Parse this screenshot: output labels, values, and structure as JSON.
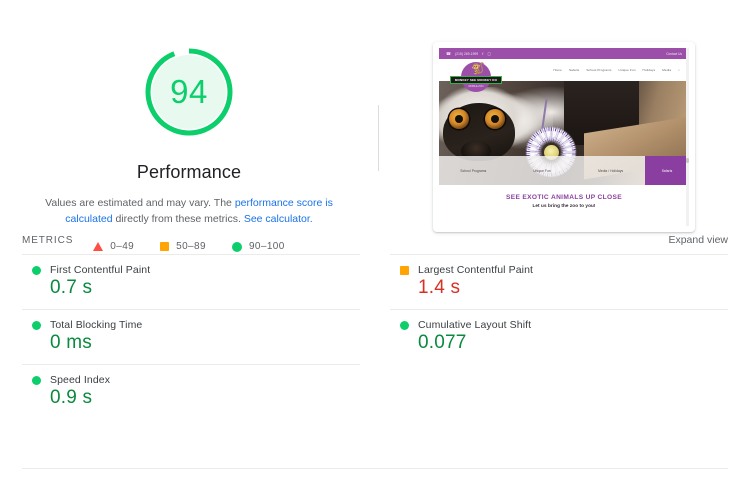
{
  "score": {
    "value": "94",
    "value_number": 94,
    "title": "Performance",
    "ring_color": "#0cce6b",
    "fill_color": "#e8faf0"
  },
  "description": {
    "part1": "Values are estimated and may vary. The ",
    "link1": "performance score is calculated",
    "part2": " directly from these metrics. ",
    "link2": "See calculator."
  },
  "legend": {
    "items": [
      {
        "icon": "triangle-icon",
        "label": "0–49",
        "color": "#ff4e42"
      },
      {
        "icon": "square-icon",
        "label": "50–89",
        "color": "#ffa400"
      },
      {
        "icon": "circle-icon",
        "label": "90–100",
        "color": "#0cce6b"
      }
    ]
  },
  "thumbnail": {
    "topbar": {
      "phone": "(215) 269-1999",
      "contact": "Contact Us"
    },
    "logo": {
      "band": "MONKEY SEE MONKEY DO",
      "sub": "MOBILE ZOO"
    },
    "nav": [
      "Home",
      "Safaris",
      "School Programs",
      "Unique Fun",
      "Holidays",
      "Media"
    ],
    "categories": [
      "School Programs",
      "Unique Fun",
      "Media / Holidays"
    ],
    "cta": "Safaris",
    "caption_main": "SEE EXOTIC ANIMALS UP CLOSE",
    "caption_sub": "Let us bring the zoo to you!",
    "brand_purple": "#8a3fa0"
  },
  "metrics": {
    "section_label": "METRICS",
    "expand_label": "Expand view",
    "items": [
      {
        "name": "First Contentful Paint",
        "value": "0.7 s",
        "status": "pass"
      },
      {
        "name": "Largest Contentful Paint",
        "value": "1.4 s",
        "status": "avg"
      },
      {
        "name": "Total Blocking Time",
        "value": "0 ms",
        "status": "pass"
      },
      {
        "name": "Cumulative Layout Shift",
        "value": "0.077",
        "status": "pass"
      },
      {
        "name": "Speed Index",
        "value": "0.9 s",
        "status": "pass"
      }
    ]
  }
}
